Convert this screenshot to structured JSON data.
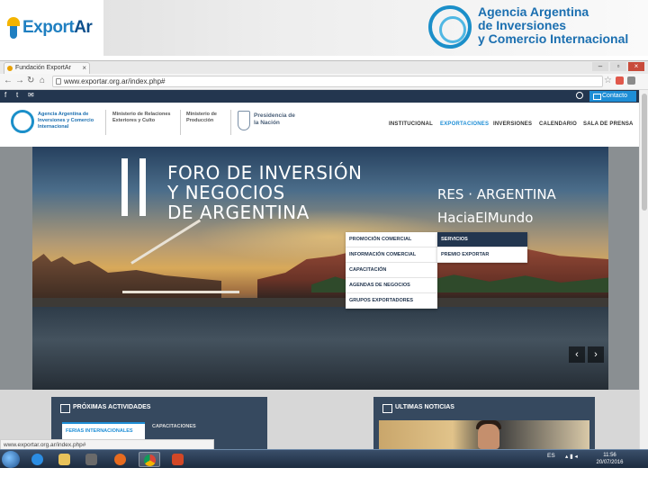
{
  "slide_header": {
    "exportar_logo": {
      "part1": "Export",
      "part2": "Ar"
    },
    "agencia_logo": {
      "line1": "Agencia Argentina",
      "line2": "de Inversiones",
      "line3": "y Comercio Internacional"
    }
  },
  "browser": {
    "tab_title": "Fundación ExportAr",
    "address": "www.exportar.org.ar/index.php#",
    "status_url": "www.exportar.org.ar/index.php#"
  },
  "site": {
    "topbar": {
      "contact_label": "Contacto"
    },
    "logo_text": "Agencia Argentina de Inversiones y Comercio Internacional",
    "ministry1": "Ministerio de Relaciones Exteriores y Culto",
    "ministry2": "Ministerio de Producción",
    "presidency": "Presidencia de la Nación",
    "nav": [
      "INSTITUCIONAL",
      "EXPORTACIONES",
      "INVERSIONES",
      "CALENDARIO",
      "SALA DE PRENSA"
    ],
    "dropdown": [
      "PROMOCIÓN COMERCIAL",
      "INFORMACIÓN COMERCIAL",
      "CAPACITACIÓN",
      "AGENDAS DE NEGOCIOS",
      "GRUPOS EXPORTADORES"
    ],
    "submenu": [
      "SERVICIOS",
      "PREMIO EXPORTAR"
    ],
    "hero": {
      "title_line1": "FORO DE INVERSIÓN",
      "title_line2": "Y NEGOCIOS",
      "title_line3": "DE ARGENTINA",
      "subtitle1": "RES · ARGENTINA",
      "subtitle2": "HaciaElMundo"
    },
    "panels": {
      "activities_title": "PRÓXIMAS ACTIVIDADES",
      "activities_tab1": "FERIAS INTERNACIONALES",
      "activities_tab2": "CAPACITACIONES",
      "news_title": "ULTIMAS NOTICIAS"
    }
  },
  "taskbar": {
    "language": "ES",
    "time": "11:56",
    "date": "20/07/2016"
  },
  "colors": {
    "site_navy": "#23364f",
    "accent_blue": "#1e8ed6"
  }
}
